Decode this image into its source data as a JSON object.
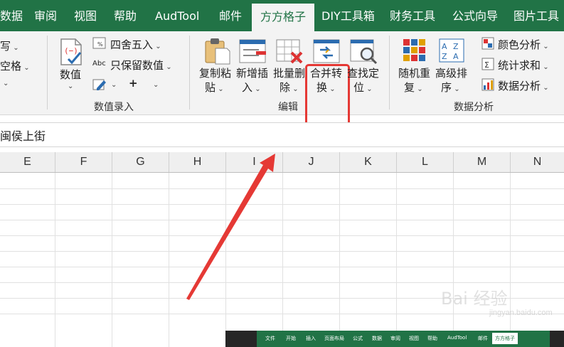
{
  "tabs": [
    {
      "label": "数据",
      "active": false
    },
    {
      "label": "审阅",
      "active": false
    },
    {
      "label": "视图",
      "active": false
    },
    {
      "label": "帮助",
      "active": false
    },
    {
      "label": "AudTool",
      "active": false
    },
    {
      "label": "邮件",
      "active": false
    },
    {
      "label": "方方格子",
      "active": true
    },
    {
      "label": "DIY工具箱",
      "active": false
    },
    {
      "label": "财务工具",
      "active": false
    },
    {
      "label": "公式向导",
      "active": false
    },
    {
      "label": "图片工具",
      "active": false
    }
  ],
  "ribbon": {
    "left_partial": {
      "write": "写",
      "space": "空格"
    },
    "numeric": {
      "value_label": "数值",
      "round_label": "四舍五入",
      "keep_label": "只保留数值",
      "abc_label": "Abc",
      "plus_label": "+",
      "group_label": "数值录入"
    },
    "edit": {
      "copy_paste": [
        "复制粘",
        "贴"
      ],
      "insert": [
        "新增插",
        "入"
      ],
      "delete": [
        "批量删",
        "除"
      ],
      "merge": [
        "合并转",
        "换"
      ],
      "find": [
        "查找定",
        "位"
      ],
      "group_label": "编辑"
    },
    "analysis": {
      "random": [
        "随机重",
        "复"
      ],
      "sort": [
        "高级排",
        "序"
      ],
      "color": "颜色分析",
      "stats": "统计求和",
      "data": "数据分析",
      "group_label": "数据分析"
    }
  },
  "formula_bar": {
    "text": "闽侯上街"
  },
  "columns": [
    "E",
    "F",
    "G",
    "H",
    "I",
    "J",
    "K",
    "L",
    "M",
    "N"
  ],
  "colors": {
    "excel_green": "#217346",
    "highlight_red": "#e53935",
    "arrow_red": "#e53935"
  },
  "mini_ribbon": {
    "tabs": [
      "文件",
      "开始",
      "插入",
      "页面布局",
      "公式",
      "数据",
      "审阅",
      "视图",
      "帮助",
      "AudTool",
      "邮件",
      "方方格子"
    ],
    "active": "方方格子"
  },
  "watermark": {
    "text": "Bai 经验",
    "sub": "jingyan.baidu.com"
  }
}
